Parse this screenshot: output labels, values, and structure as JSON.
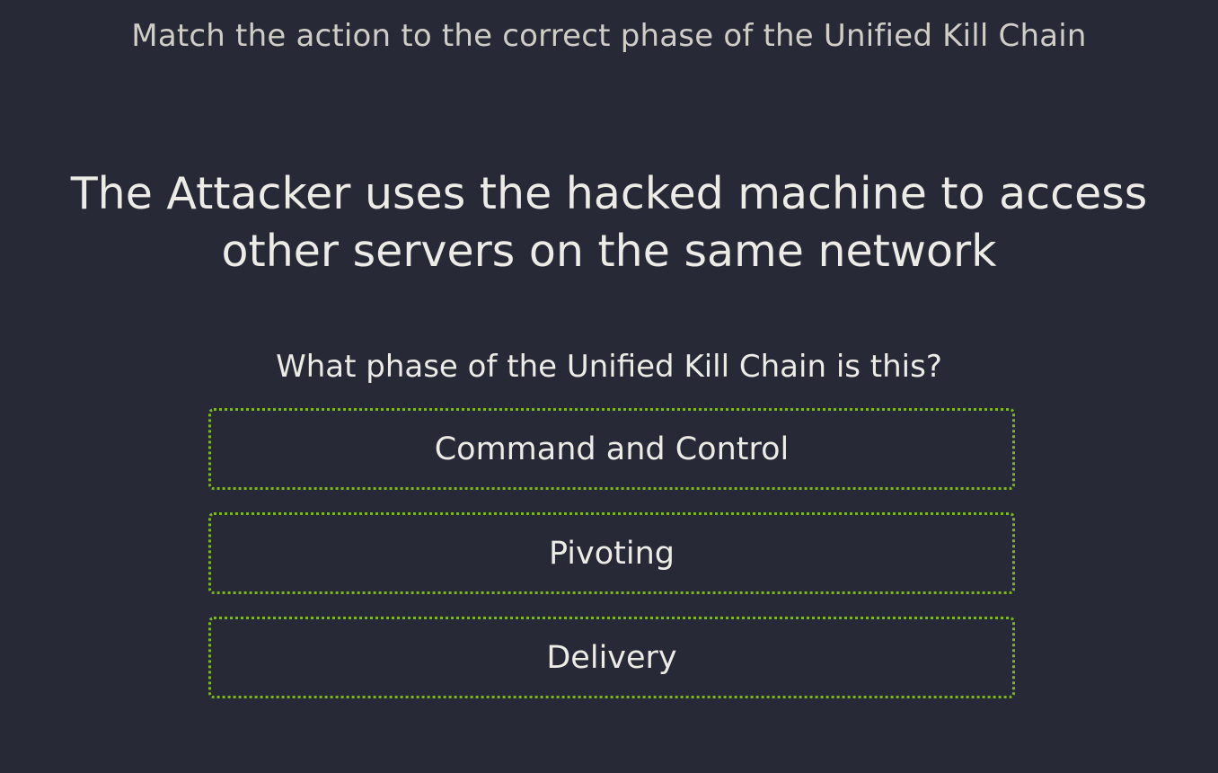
{
  "header": {
    "title": "Match the action to the correct phase of the Unified Kill Chain"
  },
  "statement": {
    "text": "The Attacker uses the hacked machine to access other servers on the same network"
  },
  "question": {
    "text": "What phase of the Unified Kill Chain is this?"
  },
  "options": [
    {
      "label": "Command and Control"
    },
    {
      "label": "Pivoting"
    },
    {
      "label": "Delivery"
    }
  ],
  "colors": {
    "background": "#272a36",
    "option_border": "#7fb51f",
    "text": "#ecebe6"
  }
}
